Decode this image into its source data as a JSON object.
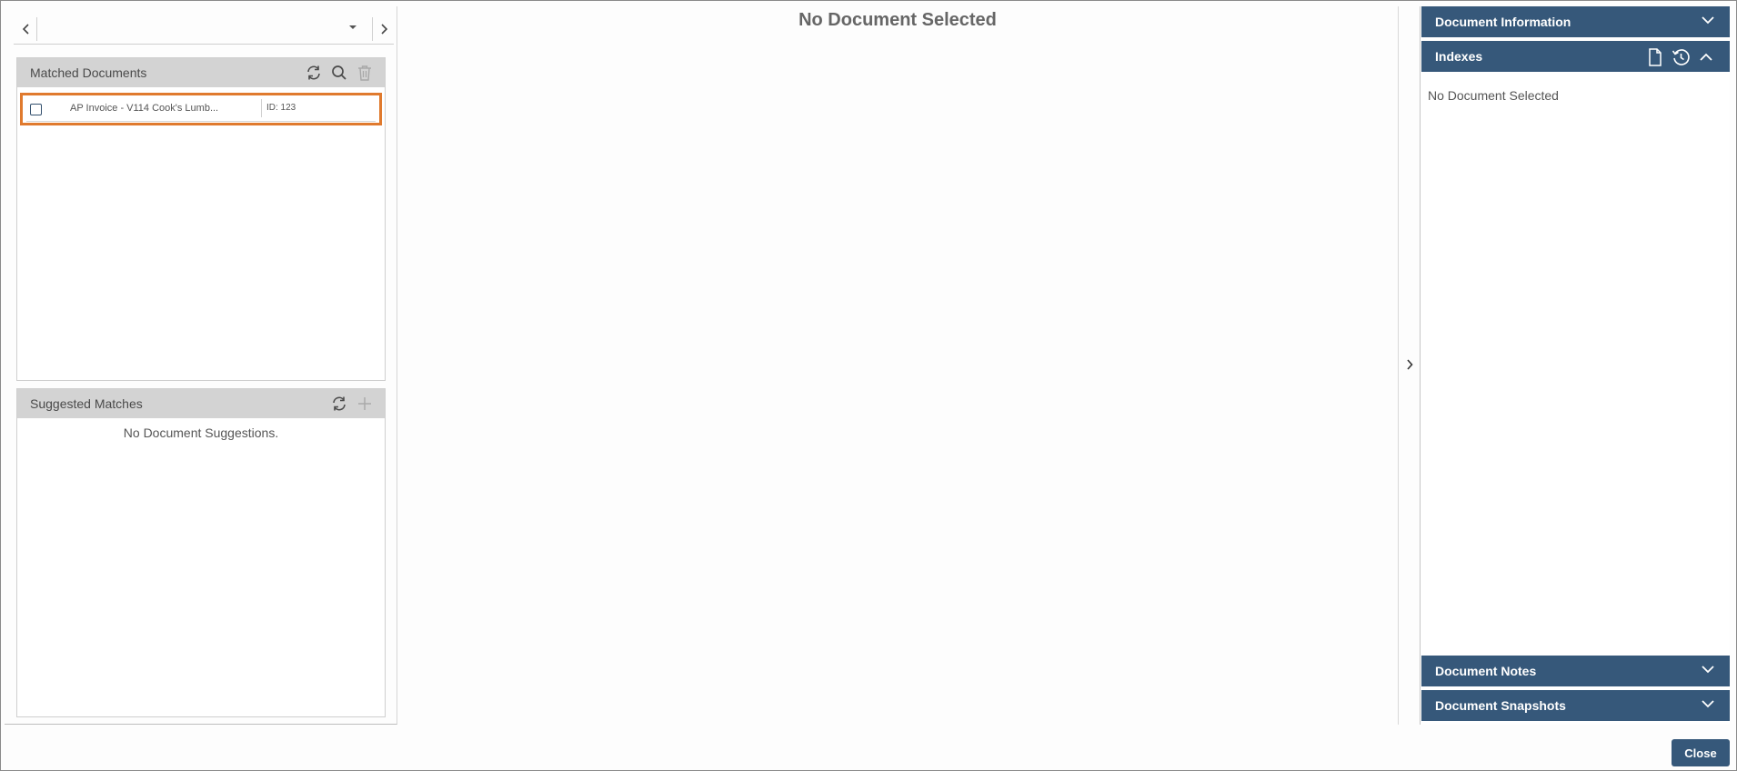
{
  "navigator": {
    "selected_value": "",
    "prev_icon": "chevron-left-icon",
    "next_icon": "chevron-right-icon"
  },
  "matched": {
    "title": "Matched Documents",
    "documents": [
      {
        "title": "AP Invoice - V114 Cook's Lumb...",
        "id_label": "ID: 123",
        "checked": false
      }
    ],
    "icons": [
      "refresh-icon",
      "search-icon",
      "trash-icon"
    ]
  },
  "suggested": {
    "title": "Suggested Matches",
    "empty_text": "No Document Suggestions.",
    "icons": [
      "refresh-icon",
      "plus-icon"
    ]
  },
  "viewer": {
    "title": "No Document Selected"
  },
  "right_panel": {
    "document_information": "Document Information",
    "indexes": "Indexes",
    "indexes_empty": "No Document Selected",
    "document_notes": "Document Notes",
    "document_snapshots": "Document Snapshots"
  },
  "footer": {
    "close_label": "Close"
  },
  "colors": {
    "accent": "#36587a",
    "highlight": "#e07a2e",
    "section_header": "#d3d3d3"
  }
}
